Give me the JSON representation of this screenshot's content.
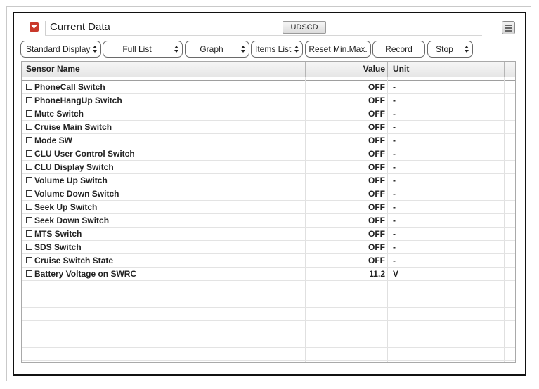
{
  "header": {
    "title": "Current Data",
    "protocol_label": "UDSCD"
  },
  "toolbar": {
    "standard_display": "Standard Display",
    "full_list": "Full List",
    "graph": "Graph",
    "items_list": "Items List",
    "reset_minmax": "Reset Min.Max.",
    "record": "Record",
    "stop": "Stop"
  },
  "table": {
    "columns": {
      "name": "Sensor Name",
      "value": "Value",
      "unit": "Unit"
    },
    "rows": [
      {
        "name": "PhoneCall Switch",
        "value": "OFF",
        "unit": "-"
      },
      {
        "name": "PhoneHangUp Switch",
        "value": "OFF",
        "unit": "-"
      },
      {
        "name": "Mute Switch",
        "value": "OFF",
        "unit": "-"
      },
      {
        "name": "Cruise Main Switch",
        "value": "OFF",
        "unit": "-"
      },
      {
        "name": "Mode SW",
        "value": "OFF",
        "unit": "-"
      },
      {
        "name": "CLU User Control Switch",
        "value": "OFF",
        "unit": "-"
      },
      {
        "name": "CLU Display Switch",
        "value": "OFF",
        "unit": "-"
      },
      {
        "name": "Volume Up Switch",
        "value": "OFF",
        "unit": "-"
      },
      {
        "name": "Volume Down Switch",
        "value": "OFF",
        "unit": "-"
      },
      {
        "name": "Seek Up Switch",
        "value": "OFF",
        "unit": "-"
      },
      {
        "name": "Seek Down Switch",
        "value": "OFF",
        "unit": "-"
      },
      {
        "name": "MTS Switch",
        "value": "OFF",
        "unit": "-"
      },
      {
        "name": "SDS Switch",
        "value": "OFF",
        "unit": "-"
      },
      {
        "name": "Cruise Switch State",
        "value": "OFF",
        "unit": "-"
      },
      {
        "name": "Battery Voltage on SWRC",
        "value": "11.2",
        "unit": "V"
      }
    ]
  },
  "colors": {
    "accent": "#c9392b",
    "frame": "#111111"
  },
  "icons": {
    "collapse": "collapse-arrow-icon",
    "menu": "menu-icon",
    "spinner": "spinner-arrows-icon"
  }
}
